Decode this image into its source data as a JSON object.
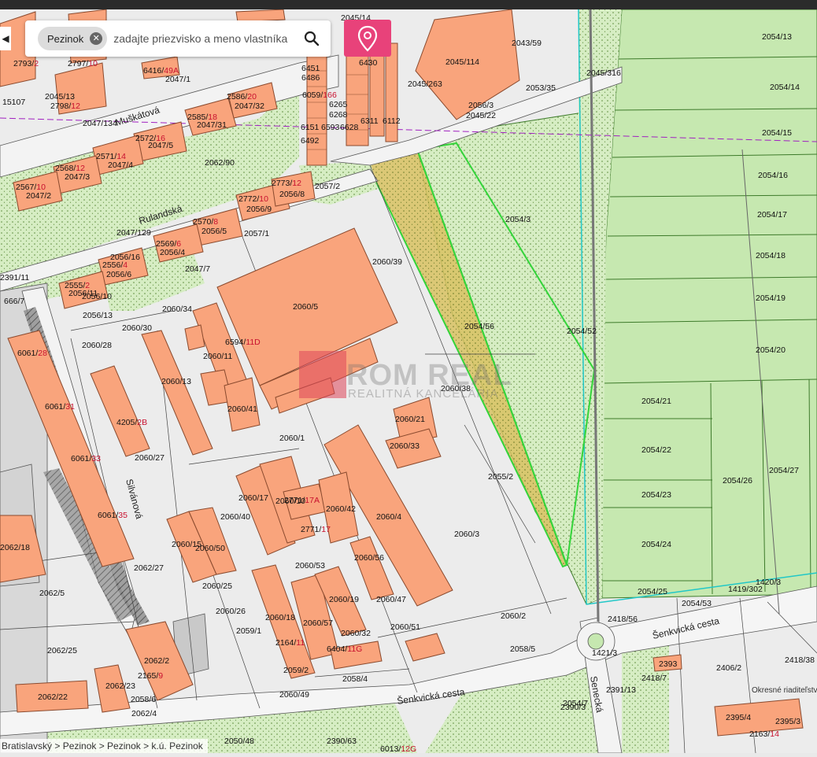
{
  "search": {
    "chip": "Pezinok",
    "placeholder": "zadajte priezvisko a meno vlastníka"
  },
  "breadcrumb": "Bratislavský > Pezinok > Pezinok > k.ú. Pezinok",
  "watermark": {
    "line1": "ROM REAL",
    "line2": "REALITNÁ KANCELÁRIA"
  },
  "streets": [
    "Muškátová",
    "Rulandská",
    "Silvánová",
    "Šenkvická cesta",
    "Senecká"
  ],
  "building_labels": [
    "2045/114",
    "2043/59",
    "6430",
    "6451",
    "6486",
    "6059/166",
    "6265",
    "6268",
    "6311",
    "6112",
    "6151",
    "6593",
    "6628",
    "6492",
    "2060/5",
    "6594/11D",
    "2060/11",
    "2060/41",
    "2060/13",
    "2060/1",
    "2060/4",
    "2060/21",
    "2060/33",
    "2060/17",
    "2060/10",
    "2771/17A",
    "2771/17",
    "2060/42",
    "2060/15",
    "2060/50",
    "2060/18",
    "2060/57",
    "2060/19",
    "6404/11G",
    "2164/11",
    "2060/56",
    "2060/47",
    "2062/2",
    "2165/9",
    "2062/22",
    "2062/23",
    "2062/18",
    "6061/28",
    "6061/31",
    "6061/33",
    "6061/35",
    "4205/2B",
    "2772/10",
    "2773/12",
    "2056/8",
    "2056/9",
    "2570/8",
    "2056/5",
    "2569/6",
    "2056/4",
    "2556/4",
    "2056/6",
    "2555/2",
    "2056/11",
    "2568/12",
    "2047/3",
    "2567/10",
    "2047/2",
    "2571/14",
    "2047/4",
    "2572/16",
    "2047/5",
    "2585/18",
    "2047/31",
    "2586/20",
    "2047/32",
    "2045/13",
    "2798/12",
    "2797/10",
    "2793/2",
    "6416/49A",
    "2395/4",
    "2395/3",
    "2163/14",
    "6013/12G",
    "2393",
    "2418/7"
  ],
  "parcel_labels": [
    "2054/13",
    "2054/14",
    "2054/15",
    "2054/16",
    "2054/17",
    "2054/18",
    "2054/19",
    "2054/20",
    "2054/21",
    "2054/22",
    "2054/23",
    "2054/24",
    "2054/25",
    "2054/26",
    "2054/27",
    "2054/3",
    "2054/56",
    "2054/52",
    "2054/53",
    "2055/2",
    "2060/3",
    "2060/2",
    "2060/39",
    "2060/38",
    "2060/34",
    "2060/30",
    "2060/28",
    "2060/27",
    "2060/40",
    "2060/25",
    "2060/26",
    "2060/53",
    "2060/32",
    "2060/51",
    "2059/1",
    "2059/2",
    "2060/49",
    "2058/4",
    "2058/5",
    "2058/6",
    "2062/4",
    "2062/5",
    "2062/25",
    "2062/27",
    "2062/90",
    "2047/1",
    "2047/134",
    "2047/129",
    "2047/7",
    "2057/1",
    "2057/2",
    "2056/10",
    "2056/13",
    "2056/16",
    "2056/3",
    "2045/22",
    "2050/48",
    "2390/63",
    "2390/3",
    "2391/13",
    "2406/2",
    "2418/38",
    "2418/56",
    "1419/302",
    "1420/3",
    "1421/3",
    "15107",
    "2045/14",
    "2045/263",
    "2045/316",
    "2053/35",
    "2054/7",
    "2391/11",
    "666/7",
    "6685"
  ],
  "labels": {
    "office": "Okresné riaditeľstvo PZ Pezinok"
  },
  "colors": {
    "building": "#f9a47c",
    "building_stroke": "#8a4a2e",
    "highlight_parcel": "#d9c15e",
    "green_parcels": "#c6e8b0",
    "grass": "#d3ecc0",
    "search_pin_button": "#e8427a"
  }
}
